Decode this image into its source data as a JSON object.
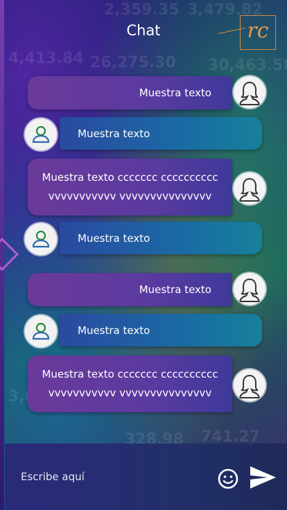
{
  "header": {
    "title": "Chat",
    "logo_text": "rc"
  },
  "messages": [
    {
      "side": "sent",
      "text": "Muestra texto"
    },
    {
      "side": "received",
      "text": "Muestra texto"
    },
    {
      "side": "sent",
      "text": "Muestra texto ccccccc cccccccccc vvvvvvvvvvv vvvvvvvvvvvvvvv"
    },
    {
      "side": "received",
      "text": "Muestra texto"
    },
    {
      "side": "sent",
      "text": "Muestra texto"
    },
    {
      "side": "received",
      "text": "Muestra texto"
    },
    {
      "side": "sent",
      "text": "Muestra texto ccccccc cccccccccc vvvvvvvvvvv vvvvvvvvvvvvvvv"
    }
  ],
  "composer": {
    "placeholder": "Escribe aquí"
  },
  "icons": {
    "emoji": "emoji-icon",
    "send": "send-icon",
    "sent_avatar": "woman-avatar-icon",
    "received_avatar": "user-avatar-icon"
  },
  "colors": {
    "sent_bubble": "#5a3aa0",
    "received_bubble": "#1a6aa5",
    "accent": "#d98a3a"
  }
}
